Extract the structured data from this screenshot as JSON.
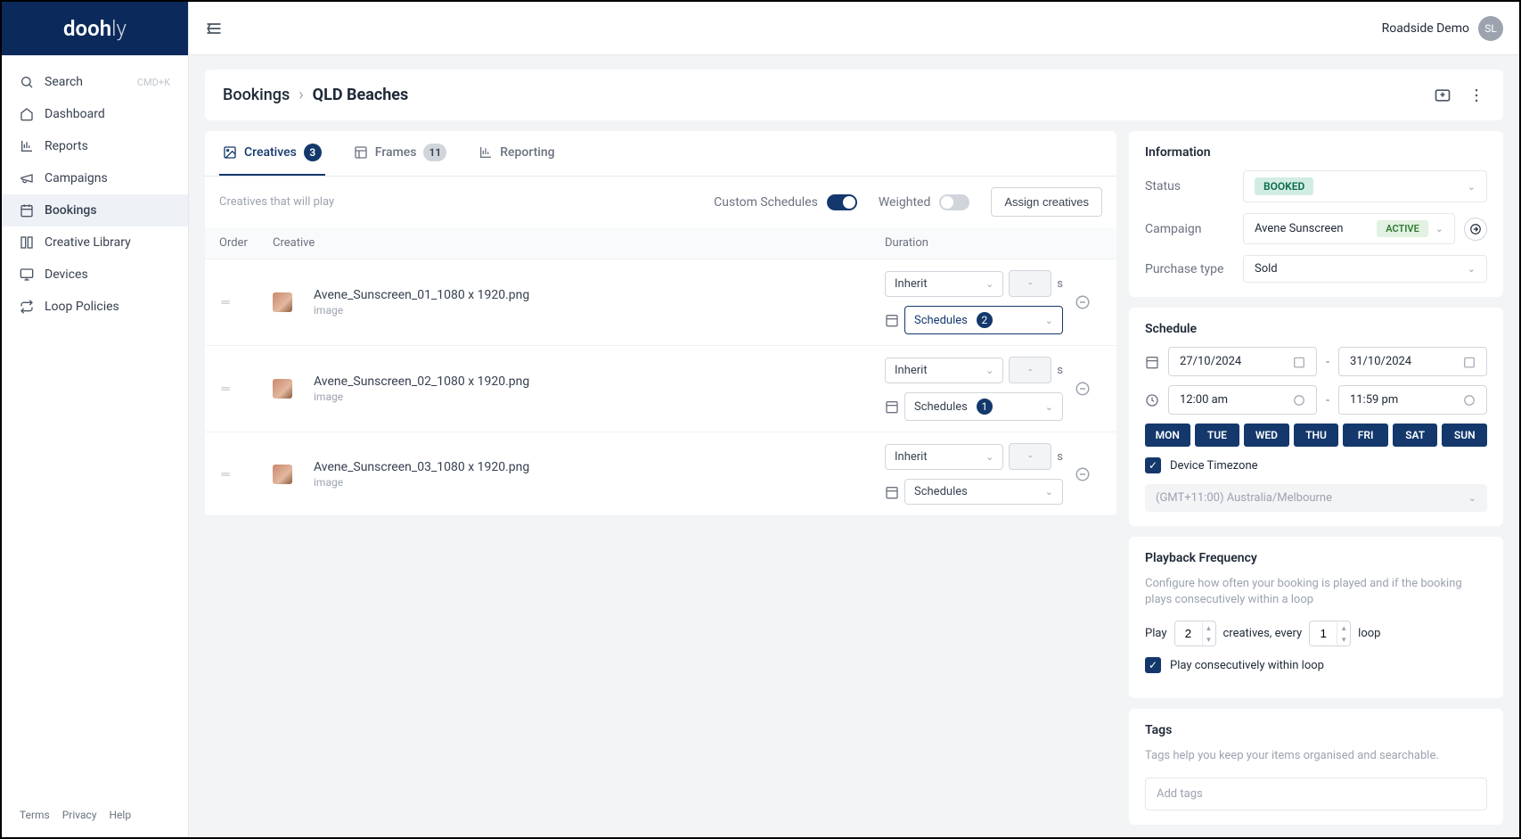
{
  "brand": {
    "name": "dooh",
    "suffix": "ly"
  },
  "topbar": {
    "user_name": "Roadside Demo",
    "avatar_initials": "SL"
  },
  "sidebar": {
    "search": {
      "label": "Search",
      "shortcut": "CMD+K"
    },
    "items": [
      {
        "label": "Dashboard",
        "icon": "home"
      },
      {
        "label": "Reports",
        "icon": "chart"
      },
      {
        "label": "Campaigns",
        "icon": "megaphone"
      },
      {
        "label": "Bookings",
        "icon": "calendar",
        "active": true
      },
      {
        "label": "Creative Library",
        "icon": "library"
      },
      {
        "label": "Devices",
        "icon": "monitor"
      },
      {
        "label": "Loop Policies",
        "icon": "loop"
      }
    ],
    "footer": [
      "Terms",
      "Privacy",
      "Help"
    ]
  },
  "breadcrumb": {
    "root": "Bookings",
    "current": "QLD Beaches"
  },
  "tabs": [
    {
      "label": "Creatives",
      "count": 3,
      "active": true
    },
    {
      "label": "Frames",
      "count": 11,
      "active": false
    },
    {
      "label": "Reporting",
      "active": false
    }
  ],
  "creatives_section": {
    "hint": "Creatives that will play",
    "custom_schedules_label": "Custom Schedules",
    "custom_schedules_on": true,
    "weighted_label": "Weighted",
    "weighted_on": false,
    "assign_button": "Assign creatives",
    "columns": {
      "order": "Order",
      "creative": "Creative",
      "duration": "Duration"
    },
    "rows": [
      {
        "name": "Avene_Sunscreen_01_1080 x 1920.png",
        "type": "image",
        "duration_mode": "Inherit",
        "duration_value": "-",
        "unit": "s",
        "schedules_label": "Schedules",
        "schedules_count": 2,
        "schedules_highlighted": true
      },
      {
        "name": "Avene_Sunscreen_02_1080 x 1920.png",
        "type": "image",
        "duration_mode": "Inherit",
        "duration_value": "-",
        "unit": "s",
        "schedules_label": "Schedules",
        "schedules_count": 1,
        "schedules_highlighted": false
      },
      {
        "name": "Avene_Sunscreen_03_1080 x 1920.png",
        "type": "image",
        "duration_mode": "Inherit",
        "duration_value": "-",
        "unit": "s",
        "schedules_label": "Schedules",
        "schedules_count": null,
        "schedules_highlighted": false
      }
    ]
  },
  "info_panel": {
    "title": "Information",
    "status_label": "Status",
    "status_value": "BOOKED",
    "campaign_label": "Campaign",
    "campaign_value": "Avene Sunscreen",
    "campaign_badge": "ACTIVE",
    "purchase_label": "Purchase type",
    "purchase_value": "Sold"
  },
  "schedule_panel": {
    "title": "Schedule",
    "date_from": "27/10/2024",
    "date_to": "31/10/2024",
    "time_from": "12:00 am",
    "time_to": "11:59 pm",
    "days": [
      "MON",
      "TUE",
      "WED",
      "THU",
      "FRI",
      "SAT",
      "SUN"
    ],
    "device_tz_label": "Device Timezone",
    "device_tz_checked": true,
    "tz_value": "(GMT+11:00) Australia/Melbourne"
  },
  "playback_panel": {
    "title": "Playback Frequency",
    "description": "Configure how often your booking is played and if the booking plays consecutively within a loop",
    "play_label": "Play",
    "play_count": "2",
    "creatives_label": "creatives, every",
    "loop_count": "1",
    "loop_label": "loop",
    "consecutive_label": "Play consecutively within loop",
    "consecutive_checked": true
  },
  "tags_panel": {
    "title": "Tags",
    "description": "Tags help you keep your items organised and searchable.",
    "placeholder": "Add tags"
  }
}
